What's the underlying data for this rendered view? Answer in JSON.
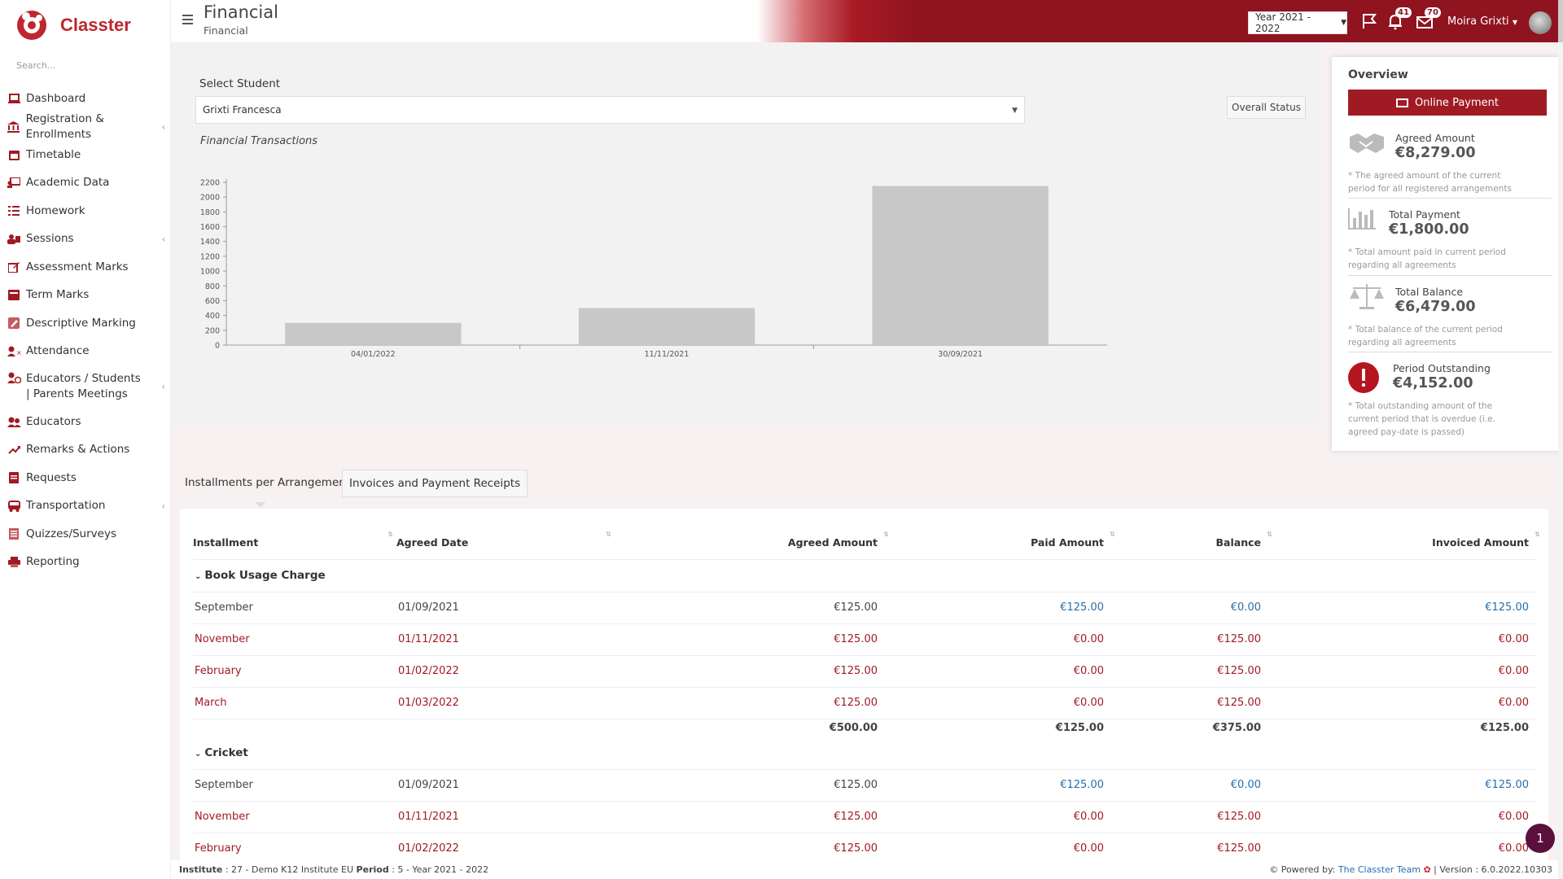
{
  "app": {
    "name": "Classter"
  },
  "sidebar": {
    "search_placeholder": "Search...",
    "items": [
      {
        "label": "Dashboard"
      },
      {
        "label": "Registration & Enrollments"
      },
      {
        "label": "Timetable"
      },
      {
        "label": "Academic Data"
      },
      {
        "label": "Homework"
      },
      {
        "label": "Sessions"
      },
      {
        "label": "Assessment Marks"
      },
      {
        "label": "Term Marks"
      },
      {
        "label": "Descriptive Marking"
      },
      {
        "label": "Attendance"
      },
      {
        "label": "Educators / Students | Parents Meetings"
      },
      {
        "label": "Educators"
      },
      {
        "label": "Remarks & Actions"
      },
      {
        "label": "Requests"
      },
      {
        "label": "Transportation"
      },
      {
        "label": "Quizzes/Surveys"
      },
      {
        "label": "Reporting"
      }
    ]
  },
  "header": {
    "title": "Financial",
    "subtitle": "Financial",
    "year": "Year 2021 - 2022",
    "notifications_count": "41",
    "messages_count": "70",
    "user_name": "Moira Grixti"
  },
  "student_select": {
    "label": "Select Student",
    "value": "Grixti Francesca"
  },
  "overall_status": "Overall Status",
  "chart_data": {
    "type": "bar",
    "title": "Financial Transactions",
    "categories": [
      "04/01/2022",
      "11/11/2021",
      "30/09/2021"
    ],
    "values": [
      300,
      500,
      2150
    ],
    "ylim": [
      0,
      2200
    ],
    "yticks": [
      0,
      200,
      400,
      600,
      800,
      1000,
      1200,
      1400,
      1600,
      1800,
      2000,
      2200
    ],
    "color": "#c8c8c8"
  },
  "overview": {
    "title": "Overview",
    "button": "Online Payment",
    "cards": [
      {
        "label": "Agreed Amount",
        "amount": "€8,279.00",
        "note": "* The agreed amount of the current period for all registered arrangements",
        "icon": "handshake-icon"
      },
      {
        "label": "Total Payment",
        "amount": "€1,800.00",
        "note": "* Total amount paid in current period regarding all agreements",
        "icon": "bar-chart-icon"
      },
      {
        "label": "Total Balance",
        "amount": "€6,479.00",
        "note": "* Total balance of the current period regarding all agreements",
        "icon": "balance-scale-icon"
      },
      {
        "label": "Period Outstanding",
        "amount": "€4,152.00",
        "note": "* Total outstanding amount of the current period that is overdue (i.e. agreed pay-date is passed)",
        "icon": "exclamation-icon"
      }
    ]
  },
  "tabs": [
    {
      "label": "Installments per Arrangement"
    },
    {
      "label": "Invoices and Payment Receipts"
    }
  ],
  "table": {
    "columns": [
      "Installment",
      "Agreed Date",
      "Agreed Amount",
      "Paid Amount",
      "Balance",
      "Invoiced Amount"
    ],
    "groups": [
      {
        "name": "Book Usage Charge",
        "rows": [
          {
            "installment": "September",
            "date": "01/09/2021",
            "agreed": "€125.00",
            "paid": "€125.00",
            "balance": "€0.00",
            "invoiced": "€125.00",
            "status": "paid"
          },
          {
            "installment": "November",
            "date": "01/11/2021",
            "agreed": "€125.00",
            "paid": "€0.00",
            "balance": "€125.00",
            "invoiced": "€0.00",
            "status": "overdue"
          },
          {
            "installment": "February",
            "date": "01/02/2022",
            "agreed": "€125.00",
            "paid": "€0.00",
            "balance": "€125.00",
            "invoiced": "€0.00",
            "status": "overdue"
          },
          {
            "installment": "March",
            "date": "01/03/2022",
            "agreed": "€125.00",
            "paid": "€0.00",
            "balance": "€125.00",
            "invoiced": "€0.00",
            "status": "overdue"
          }
        ],
        "totals": {
          "agreed": "€500.00",
          "paid": "€125.00",
          "balance": "€375.00",
          "invoiced": "€125.00"
        }
      },
      {
        "name": "Cricket",
        "rows": [
          {
            "installment": "September",
            "date": "01/09/2021",
            "agreed": "€125.00",
            "paid": "€125.00",
            "balance": "€0.00",
            "invoiced": "€125.00",
            "status": "paid"
          },
          {
            "installment": "November",
            "date": "01/11/2021",
            "agreed": "€125.00",
            "paid": "€0.00",
            "balance": "€125.00",
            "invoiced": "€0.00",
            "status": "overdue"
          },
          {
            "installment": "February",
            "date": "01/02/2022",
            "agreed": "€125.00",
            "paid": "€0.00",
            "balance": "€125.00",
            "invoiced": "€0.00",
            "status": "overdue"
          }
        ]
      }
    ]
  },
  "footer": {
    "institute_label": "Institute",
    "institute_value": ": 27 - Demo K12 Institute EU",
    "period_label": "Period",
    "period_value": ": 5 - Year 2021 - 2022",
    "powered_by": "Powered by:",
    "team": "The Classter Team",
    "version": "| Version : 6.0.2022.10303"
  },
  "chat_count": "1",
  "colors": {
    "brand": "#a01a24",
    "link": "#2a6da8",
    "bar": "#c8c8c8"
  }
}
